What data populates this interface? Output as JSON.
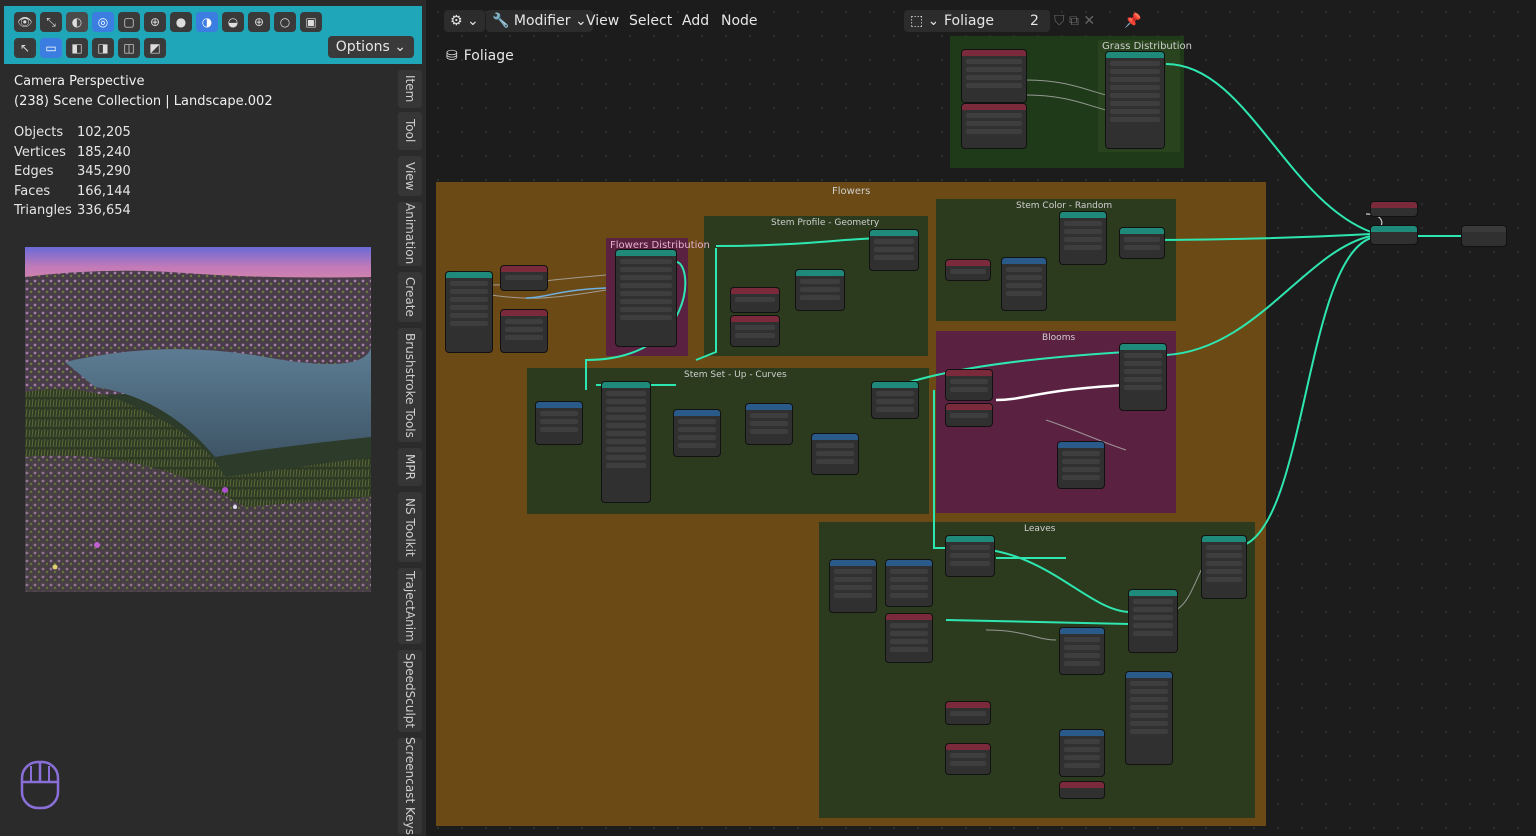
{
  "viewport_header": {
    "options_label": "Options"
  },
  "stats": {
    "mode": "Camera Perspective",
    "collection": "(238) Scene Collection | Landscape.002",
    "rows": [
      {
        "label": "Objects",
        "value": "102,205"
      },
      {
        "label": "Vertices",
        "value": "185,240"
      },
      {
        "label": "Edges",
        "value": "345,290"
      },
      {
        "label": "Faces",
        "value": "166,144"
      },
      {
        "label": "Triangles",
        "value": "336,654"
      }
    ]
  },
  "sidebar_tabs": [
    "Item",
    "Tool",
    "View",
    "Animation",
    "Create",
    "Brushstroke Tools",
    "MPR",
    "NS Toolkit",
    "TrajectAnim",
    "SpeedSculpt",
    "Screencast Keys"
  ],
  "node_editor": {
    "mode": "Modifier",
    "menus": [
      "View",
      "Select",
      "Add",
      "Node"
    ],
    "node_group": "Foliage",
    "users": "2",
    "breadcrumb": "Foliage"
  },
  "frames": {
    "grass": "Grass Distribution",
    "flowers": "Flowers",
    "flowers_dist": "Flowers Distribution",
    "stem_profile": "Stem Profile - Geometry",
    "stem_color": "Stem Color - Random",
    "blooms": "Blooms",
    "stem_setup": "Stem Set - Up - Curves",
    "leaves": "Leaves"
  },
  "colors": {
    "accent": "#1fa6b8",
    "wire": "#2ee6b0",
    "flowers_frame": "#6b4a15",
    "green_frame": "#2c3b1e",
    "pink_frame": "#5a2140",
    "grass_frame": "#1f3a18"
  }
}
